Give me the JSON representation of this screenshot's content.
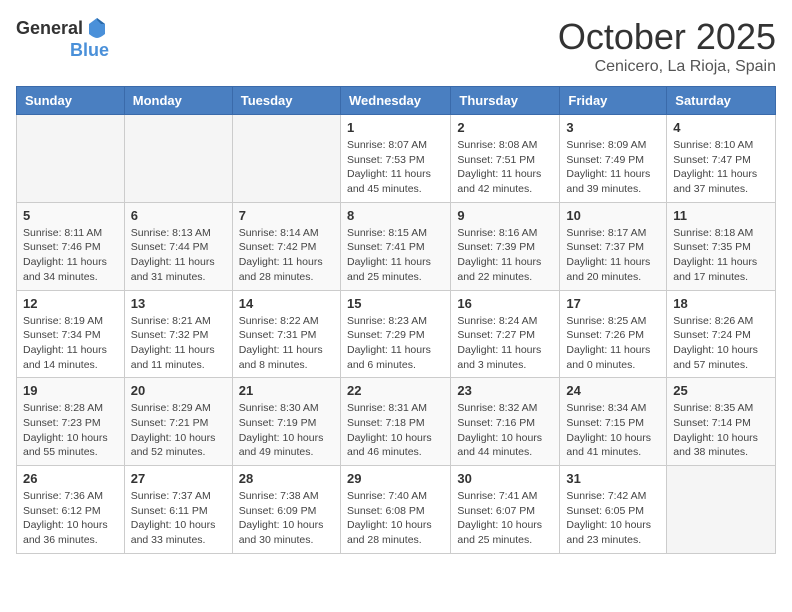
{
  "header": {
    "logo_general": "General",
    "logo_blue": "Blue",
    "month": "October 2025",
    "location": "Cenicero, La Rioja, Spain"
  },
  "days_of_week": [
    "Sunday",
    "Monday",
    "Tuesday",
    "Wednesday",
    "Thursday",
    "Friday",
    "Saturday"
  ],
  "weeks": [
    [
      {
        "day": "",
        "info": ""
      },
      {
        "day": "",
        "info": ""
      },
      {
        "day": "",
        "info": ""
      },
      {
        "day": "1",
        "info": "Sunrise: 8:07 AM\nSunset: 7:53 PM\nDaylight: 11 hours and 45 minutes."
      },
      {
        "day": "2",
        "info": "Sunrise: 8:08 AM\nSunset: 7:51 PM\nDaylight: 11 hours and 42 minutes."
      },
      {
        "day": "3",
        "info": "Sunrise: 8:09 AM\nSunset: 7:49 PM\nDaylight: 11 hours and 39 minutes."
      },
      {
        "day": "4",
        "info": "Sunrise: 8:10 AM\nSunset: 7:47 PM\nDaylight: 11 hours and 37 minutes."
      }
    ],
    [
      {
        "day": "5",
        "info": "Sunrise: 8:11 AM\nSunset: 7:46 PM\nDaylight: 11 hours and 34 minutes."
      },
      {
        "day": "6",
        "info": "Sunrise: 8:13 AM\nSunset: 7:44 PM\nDaylight: 11 hours and 31 minutes."
      },
      {
        "day": "7",
        "info": "Sunrise: 8:14 AM\nSunset: 7:42 PM\nDaylight: 11 hours and 28 minutes."
      },
      {
        "day": "8",
        "info": "Sunrise: 8:15 AM\nSunset: 7:41 PM\nDaylight: 11 hours and 25 minutes."
      },
      {
        "day": "9",
        "info": "Sunrise: 8:16 AM\nSunset: 7:39 PM\nDaylight: 11 hours and 22 minutes."
      },
      {
        "day": "10",
        "info": "Sunrise: 8:17 AM\nSunset: 7:37 PM\nDaylight: 11 hours and 20 minutes."
      },
      {
        "day": "11",
        "info": "Sunrise: 8:18 AM\nSunset: 7:35 PM\nDaylight: 11 hours and 17 minutes."
      }
    ],
    [
      {
        "day": "12",
        "info": "Sunrise: 8:19 AM\nSunset: 7:34 PM\nDaylight: 11 hours and 14 minutes."
      },
      {
        "day": "13",
        "info": "Sunrise: 8:21 AM\nSunset: 7:32 PM\nDaylight: 11 hours and 11 minutes."
      },
      {
        "day": "14",
        "info": "Sunrise: 8:22 AM\nSunset: 7:31 PM\nDaylight: 11 hours and 8 minutes."
      },
      {
        "day": "15",
        "info": "Sunrise: 8:23 AM\nSunset: 7:29 PM\nDaylight: 11 hours and 6 minutes."
      },
      {
        "day": "16",
        "info": "Sunrise: 8:24 AM\nSunset: 7:27 PM\nDaylight: 11 hours and 3 minutes."
      },
      {
        "day": "17",
        "info": "Sunrise: 8:25 AM\nSunset: 7:26 PM\nDaylight: 11 hours and 0 minutes."
      },
      {
        "day": "18",
        "info": "Sunrise: 8:26 AM\nSunset: 7:24 PM\nDaylight: 10 hours and 57 minutes."
      }
    ],
    [
      {
        "day": "19",
        "info": "Sunrise: 8:28 AM\nSunset: 7:23 PM\nDaylight: 10 hours and 55 minutes."
      },
      {
        "day": "20",
        "info": "Sunrise: 8:29 AM\nSunset: 7:21 PM\nDaylight: 10 hours and 52 minutes."
      },
      {
        "day": "21",
        "info": "Sunrise: 8:30 AM\nSunset: 7:19 PM\nDaylight: 10 hours and 49 minutes."
      },
      {
        "day": "22",
        "info": "Sunrise: 8:31 AM\nSunset: 7:18 PM\nDaylight: 10 hours and 46 minutes."
      },
      {
        "day": "23",
        "info": "Sunrise: 8:32 AM\nSunset: 7:16 PM\nDaylight: 10 hours and 44 minutes."
      },
      {
        "day": "24",
        "info": "Sunrise: 8:34 AM\nSunset: 7:15 PM\nDaylight: 10 hours and 41 minutes."
      },
      {
        "day": "25",
        "info": "Sunrise: 8:35 AM\nSunset: 7:14 PM\nDaylight: 10 hours and 38 minutes."
      }
    ],
    [
      {
        "day": "26",
        "info": "Sunrise: 7:36 AM\nSunset: 6:12 PM\nDaylight: 10 hours and 36 minutes."
      },
      {
        "day": "27",
        "info": "Sunrise: 7:37 AM\nSunset: 6:11 PM\nDaylight: 10 hours and 33 minutes."
      },
      {
        "day": "28",
        "info": "Sunrise: 7:38 AM\nSunset: 6:09 PM\nDaylight: 10 hours and 30 minutes."
      },
      {
        "day": "29",
        "info": "Sunrise: 7:40 AM\nSunset: 6:08 PM\nDaylight: 10 hours and 28 minutes."
      },
      {
        "day": "30",
        "info": "Sunrise: 7:41 AM\nSunset: 6:07 PM\nDaylight: 10 hours and 25 minutes."
      },
      {
        "day": "31",
        "info": "Sunrise: 7:42 AM\nSunset: 6:05 PM\nDaylight: 10 hours and 23 minutes."
      },
      {
        "day": "",
        "info": ""
      }
    ]
  ]
}
